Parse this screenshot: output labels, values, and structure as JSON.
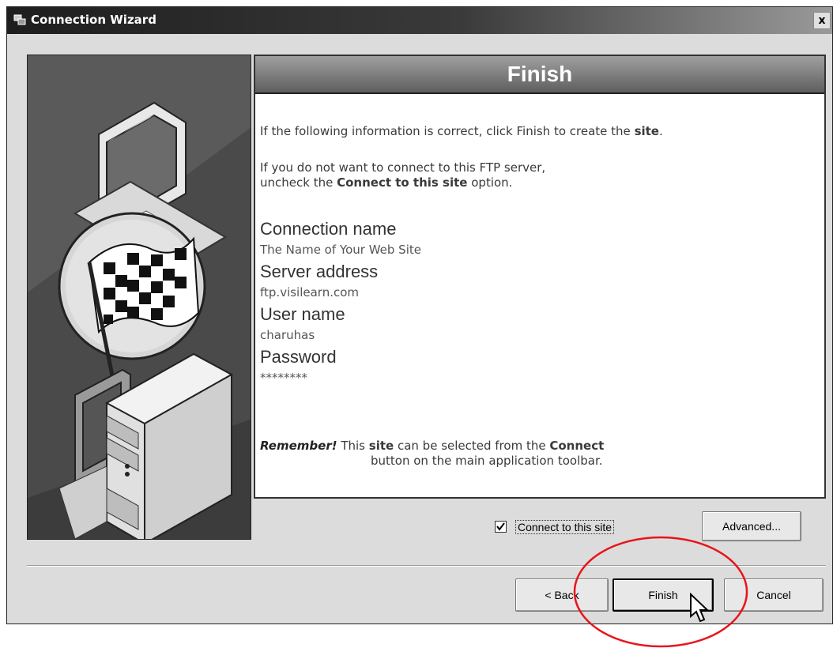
{
  "window": {
    "title": "Connection Wizard",
    "close_label": "x"
  },
  "header": {
    "title": "Finish"
  },
  "body": {
    "intro_line1_prefix": "If the following information is correct, click Finish to create the ",
    "intro_line1_bold": "site",
    "intro_line1_suffix": ".",
    "intro_line2": "If you do not want to connect to this FTP server,",
    "intro_line3_prefix": "uncheck the ",
    "intro_line3_bold": "Connect to this site",
    "intro_line3_suffix": " option."
  },
  "fields": {
    "connection_name_label": "Connection name",
    "connection_name_value": "The Name of Your Web Site",
    "server_address_label": "Server address",
    "server_address_value": "ftp.visilearn.com",
    "user_name_label": "User name",
    "user_name_value": "charuhas",
    "password_label": "Password",
    "password_value": "********"
  },
  "remember": {
    "label": "Remember!",
    "line1_prefix": "This ",
    "line1_bold": "site",
    "line1_mid": " can be selected from the ",
    "line1_bold2": "Connect",
    "line2": "button on the main application toolbar."
  },
  "options": {
    "connect_checkbox_label": "Connect to this site",
    "connect_checked": true
  },
  "buttons": {
    "advanced": "Advanced...",
    "back": "< Back",
    "finish": "Finish",
    "cancel": "Cancel"
  },
  "icons": [
    "wizard-app-icon",
    "close-icon",
    "computer-monitor-icon",
    "checkered-flag-icon",
    "computer-tower-icon",
    "checkbox-checked-icon",
    "mouse-pointer-icon"
  ],
  "colors": {
    "annotation_circle": "#e8141b",
    "header_bar": "#7a7a7a"
  }
}
